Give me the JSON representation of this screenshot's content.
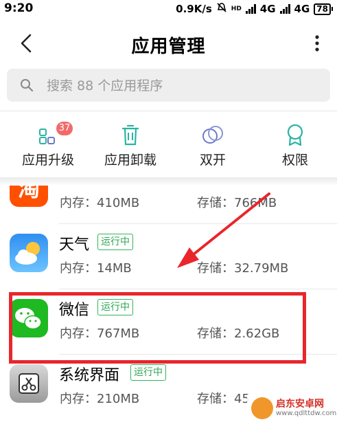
{
  "status_bar": {
    "time": "9:20",
    "net_speed": "0.9K/s",
    "hd_label": "HD",
    "net1": "4G",
    "net2": "4G",
    "battery": "78"
  },
  "header": {
    "title": "应用管理"
  },
  "search": {
    "placeholder": "搜索 88 个应用程序"
  },
  "toolbar": {
    "upgrade_label": "应用升级",
    "upgrade_badge": "37",
    "uninstall_label": "应用卸载",
    "dual_label": "双开",
    "permissions_label": "权限"
  },
  "apps": [
    {
      "name": "",
      "running": "",
      "memory": "内存：410MB",
      "storage": "存储：766MB"
    },
    {
      "name": "天气",
      "running": "运行中",
      "memory": "内存：14MB",
      "storage": "存储：32.79MB"
    },
    {
      "name": "微信",
      "running": "运行中",
      "memory": "内存：767MB",
      "storage": "存储：2.62GB"
    },
    {
      "name": "系统界面",
      "running": "运行中",
      "memory": "内存：210MB",
      "storage": "存储：45"
    }
  ],
  "watermark": {
    "brand": "启东安卓网",
    "url": "www.qdlttdw.com"
  },
  "colors": {
    "accent": "#2bb3a3",
    "running_tag": "#2ea652",
    "highlight": "#e8262c",
    "badge": "#f26b6b"
  }
}
